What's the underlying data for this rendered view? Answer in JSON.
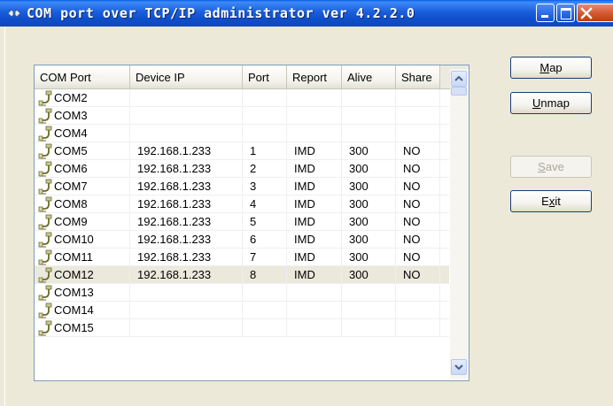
{
  "window": {
    "title": "COM port over TCP/IP administrator ver 4.2.2.0"
  },
  "list": {
    "columns": [
      "COM Port",
      "Device IP",
      "Port",
      "Report",
      "Alive",
      "Share"
    ],
    "rows": [
      {
        "com": "COM2",
        "ip": "",
        "port": "",
        "report": "",
        "alive": "",
        "share": ""
      },
      {
        "com": "COM3",
        "ip": "",
        "port": "",
        "report": "",
        "alive": "",
        "share": ""
      },
      {
        "com": "COM4",
        "ip": "",
        "port": "",
        "report": "",
        "alive": "",
        "share": ""
      },
      {
        "com": "COM5",
        "ip": "192.168.1.233",
        "port": "1",
        "report": "IMD",
        "alive": "300",
        "share": "NO"
      },
      {
        "com": "COM6",
        "ip": "192.168.1.233",
        "port": "2",
        "report": "IMD",
        "alive": "300",
        "share": "NO"
      },
      {
        "com": "COM7",
        "ip": "192.168.1.233",
        "port": "3",
        "report": "IMD",
        "alive": "300",
        "share": "NO"
      },
      {
        "com": "COM8",
        "ip": "192.168.1.233",
        "port": "4",
        "report": "IMD",
        "alive": "300",
        "share": "NO"
      },
      {
        "com": "COM9",
        "ip": "192.168.1.233",
        "port": "5",
        "report": "IMD",
        "alive": "300",
        "share": "NO"
      },
      {
        "com": "COM10",
        "ip": "192.168.1.233",
        "port": "6",
        "report": "IMD",
        "alive": "300",
        "share": "NO"
      },
      {
        "com": "COM11",
        "ip": "192.168.1.233",
        "port": "7",
        "report": "IMD",
        "alive": "300",
        "share": "NO"
      },
      {
        "com": "COM12",
        "ip": "192.168.1.233",
        "port": "8",
        "report": "IMD",
        "alive": "300",
        "share": "NO",
        "selected": true
      },
      {
        "com": "COM13",
        "ip": "",
        "port": "",
        "report": "",
        "alive": "",
        "share": ""
      },
      {
        "com": "COM14",
        "ip": "",
        "port": "",
        "report": "",
        "alive": "",
        "share": ""
      },
      {
        "com": "COM15",
        "ip": "",
        "port": "",
        "report": "",
        "alive": "",
        "share": ""
      }
    ]
  },
  "buttons": {
    "map": {
      "first": "M",
      "rest": "ap"
    },
    "unmap": {
      "first": "U",
      "rest": "nmap"
    },
    "save": {
      "first": "S",
      "rest": "ave"
    },
    "exit": {
      "pre": "E",
      "ul": "x",
      "rest": "it"
    }
  },
  "icons": {
    "app": "network-icon",
    "row": "serial-port-icon"
  },
  "colors": {
    "titlebar": "#0F4FCB",
    "window_bg": "#ECE9D8",
    "selected_row": "#EBE9DC",
    "close_button": "#D3572F"
  }
}
